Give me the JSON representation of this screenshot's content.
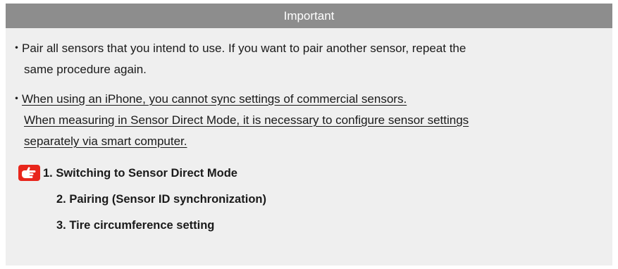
{
  "header": {
    "title": "Important"
  },
  "bullets": [
    {
      "marker": "・",
      "lines": [
        "Pair all sensors that you intend to use. If you want to pair another sensor, repeat the",
        "same procedure again."
      ],
      "underlined": false
    },
    {
      "marker": "・",
      "lines": [
        "When using an iPhone, you cannot sync settings of commercial sensors.",
        "When measuring in Sensor Direct Mode, it is necessary to configure sensor settings",
        "separately via smart computer."
      ],
      "underlined": true
    }
  ],
  "steps": [
    {
      "label": "1. Switching to Sensor Direct Mode",
      "current": true,
      "icon": "pointing-hand-icon"
    },
    {
      "label": "2. Pairing (Sensor ID synchronization)",
      "current": false
    },
    {
      "label": "3. Tire circumference setting",
      "current": false
    }
  ],
  "colors": {
    "header_bg": "#8d8d8d",
    "panel_bg": "#efefef",
    "icon_bg": "#e8261c"
  }
}
